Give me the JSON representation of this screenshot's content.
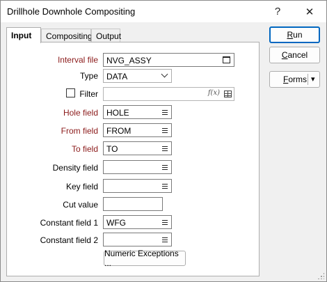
{
  "window": {
    "title": "Drillhole Downhole Compositing",
    "help_label": "?",
    "close_label": "✕"
  },
  "tabs": [
    {
      "label": "Input"
    },
    {
      "label": "Compositing"
    },
    {
      "label": "Output"
    }
  ],
  "form": {
    "interval_file": {
      "label": "Interval file",
      "value": "NVG_ASSY"
    },
    "type": {
      "label": "Type",
      "value": "DATA"
    },
    "filter": {
      "label": "Filter",
      "value": "",
      "fx_label": "f(x)"
    },
    "hole_field": {
      "label": "Hole field",
      "value": "HOLE"
    },
    "from_field": {
      "label": "From field",
      "value": "FROM"
    },
    "to_field": {
      "label": "To field",
      "value": "TO"
    },
    "density_field": {
      "label": "Density field",
      "value": ""
    },
    "key_field": {
      "label": "Key field",
      "value": ""
    },
    "cut_value": {
      "label": "Cut value",
      "value": ""
    },
    "constant_field_1": {
      "label": "Constant field 1",
      "value": "WFG"
    },
    "constant_field_2": {
      "label": "Constant field 2",
      "value": ""
    },
    "numeric_exceptions_label": "Numeric Exceptions ..."
  },
  "side_buttons": {
    "run": {
      "mnemonic": "R",
      "rest": "un"
    },
    "cancel": {
      "mnemonic": "C",
      "rest": "ancel"
    },
    "forms": {
      "mnemonic": "F",
      "rest": "orms",
      "arrow": "▾"
    }
  },
  "colors": {
    "required_label": "#8b1a1a",
    "primary_border": "#0067c0"
  }
}
